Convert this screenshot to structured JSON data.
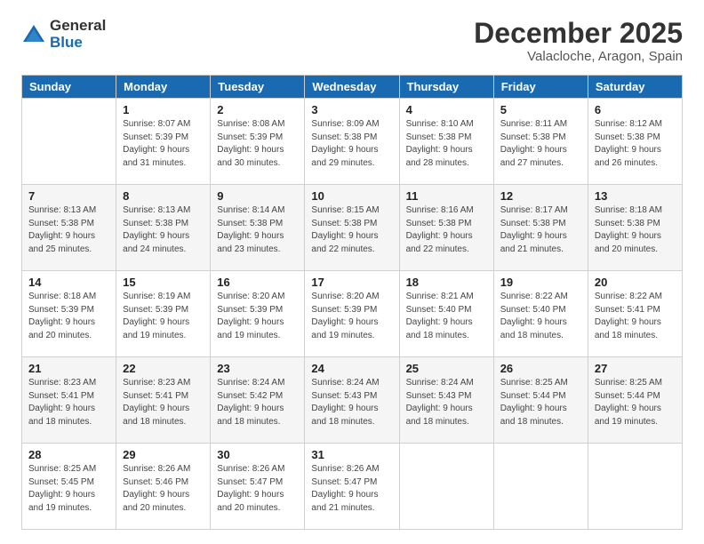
{
  "logo": {
    "general": "General",
    "blue": "Blue"
  },
  "title": "December 2025",
  "location": "Valacloche, Aragon, Spain",
  "days_header": [
    "Sunday",
    "Monday",
    "Tuesday",
    "Wednesday",
    "Thursday",
    "Friday",
    "Saturday"
  ],
  "weeks": [
    [
      {
        "num": "",
        "info": ""
      },
      {
        "num": "1",
        "info": "Sunrise: 8:07 AM\nSunset: 5:39 PM\nDaylight: 9 hours\nand 31 minutes."
      },
      {
        "num": "2",
        "info": "Sunrise: 8:08 AM\nSunset: 5:39 PM\nDaylight: 9 hours\nand 30 minutes."
      },
      {
        "num": "3",
        "info": "Sunrise: 8:09 AM\nSunset: 5:38 PM\nDaylight: 9 hours\nand 29 minutes."
      },
      {
        "num": "4",
        "info": "Sunrise: 8:10 AM\nSunset: 5:38 PM\nDaylight: 9 hours\nand 28 minutes."
      },
      {
        "num": "5",
        "info": "Sunrise: 8:11 AM\nSunset: 5:38 PM\nDaylight: 9 hours\nand 27 minutes."
      },
      {
        "num": "6",
        "info": "Sunrise: 8:12 AM\nSunset: 5:38 PM\nDaylight: 9 hours\nand 26 minutes."
      }
    ],
    [
      {
        "num": "7",
        "info": "Sunrise: 8:13 AM\nSunset: 5:38 PM\nDaylight: 9 hours\nand 25 minutes."
      },
      {
        "num": "8",
        "info": "Sunrise: 8:13 AM\nSunset: 5:38 PM\nDaylight: 9 hours\nand 24 minutes."
      },
      {
        "num": "9",
        "info": "Sunrise: 8:14 AM\nSunset: 5:38 PM\nDaylight: 9 hours\nand 23 minutes."
      },
      {
        "num": "10",
        "info": "Sunrise: 8:15 AM\nSunset: 5:38 PM\nDaylight: 9 hours\nand 22 minutes."
      },
      {
        "num": "11",
        "info": "Sunrise: 8:16 AM\nSunset: 5:38 PM\nDaylight: 9 hours\nand 22 minutes."
      },
      {
        "num": "12",
        "info": "Sunrise: 8:17 AM\nSunset: 5:38 PM\nDaylight: 9 hours\nand 21 minutes."
      },
      {
        "num": "13",
        "info": "Sunrise: 8:18 AM\nSunset: 5:38 PM\nDaylight: 9 hours\nand 20 minutes."
      }
    ],
    [
      {
        "num": "14",
        "info": "Sunrise: 8:18 AM\nSunset: 5:39 PM\nDaylight: 9 hours\nand 20 minutes."
      },
      {
        "num": "15",
        "info": "Sunrise: 8:19 AM\nSunset: 5:39 PM\nDaylight: 9 hours\nand 19 minutes."
      },
      {
        "num": "16",
        "info": "Sunrise: 8:20 AM\nSunset: 5:39 PM\nDaylight: 9 hours\nand 19 minutes."
      },
      {
        "num": "17",
        "info": "Sunrise: 8:20 AM\nSunset: 5:39 PM\nDaylight: 9 hours\nand 19 minutes."
      },
      {
        "num": "18",
        "info": "Sunrise: 8:21 AM\nSunset: 5:40 PM\nDaylight: 9 hours\nand 18 minutes."
      },
      {
        "num": "19",
        "info": "Sunrise: 8:22 AM\nSunset: 5:40 PM\nDaylight: 9 hours\nand 18 minutes."
      },
      {
        "num": "20",
        "info": "Sunrise: 8:22 AM\nSunset: 5:41 PM\nDaylight: 9 hours\nand 18 minutes."
      }
    ],
    [
      {
        "num": "21",
        "info": "Sunrise: 8:23 AM\nSunset: 5:41 PM\nDaylight: 9 hours\nand 18 minutes."
      },
      {
        "num": "22",
        "info": "Sunrise: 8:23 AM\nSunset: 5:41 PM\nDaylight: 9 hours\nand 18 minutes."
      },
      {
        "num": "23",
        "info": "Sunrise: 8:24 AM\nSunset: 5:42 PM\nDaylight: 9 hours\nand 18 minutes."
      },
      {
        "num": "24",
        "info": "Sunrise: 8:24 AM\nSunset: 5:43 PM\nDaylight: 9 hours\nand 18 minutes."
      },
      {
        "num": "25",
        "info": "Sunrise: 8:24 AM\nSunset: 5:43 PM\nDaylight: 9 hours\nand 18 minutes."
      },
      {
        "num": "26",
        "info": "Sunrise: 8:25 AM\nSunset: 5:44 PM\nDaylight: 9 hours\nand 18 minutes."
      },
      {
        "num": "27",
        "info": "Sunrise: 8:25 AM\nSunset: 5:44 PM\nDaylight: 9 hours\nand 19 minutes."
      }
    ],
    [
      {
        "num": "28",
        "info": "Sunrise: 8:25 AM\nSunset: 5:45 PM\nDaylight: 9 hours\nand 19 minutes."
      },
      {
        "num": "29",
        "info": "Sunrise: 8:26 AM\nSunset: 5:46 PM\nDaylight: 9 hours\nand 20 minutes."
      },
      {
        "num": "30",
        "info": "Sunrise: 8:26 AM\nSunset: 5:47 PM\nDaylight: 9 hours\nand 20 minutes."
      },
      {
        "num": "31",
        "info": "Sunrise: 8:26 AM\nSunset: 5:47 PM\nDaylight: 9 hours\nand 21 minutes."
      },
      {
        "num": "",
        "info": ""
      },
      {
        "num": "",
        "info": ""
      },
      {
        "num": "",
        "info": ""
      }
    ]
  ]
}
